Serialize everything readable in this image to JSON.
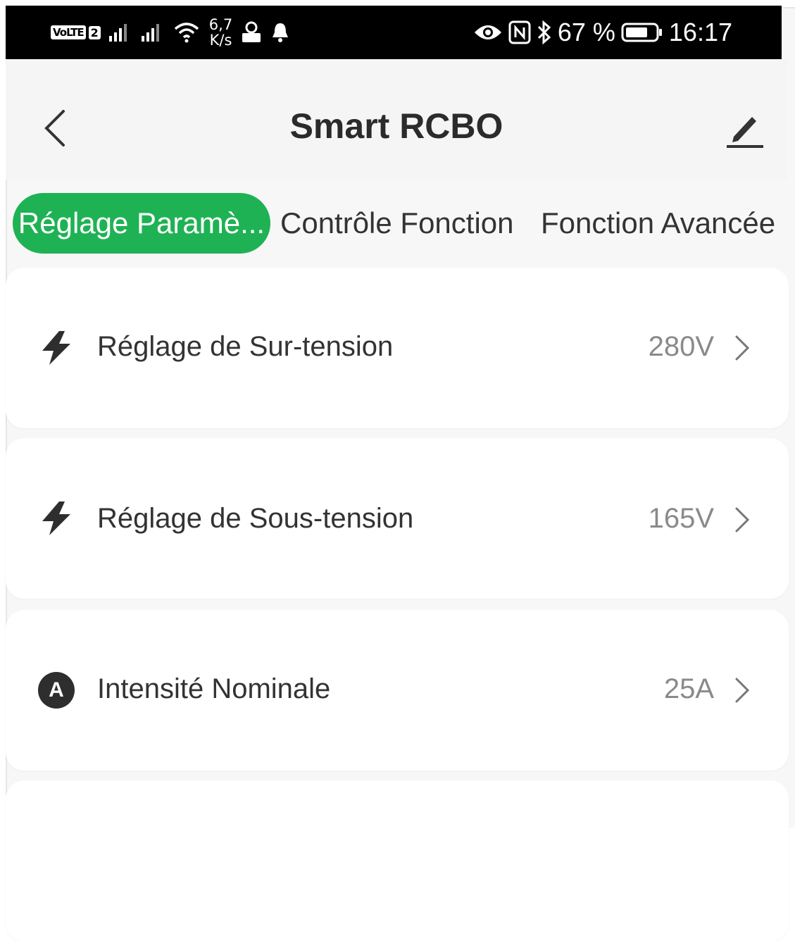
{
  "status_bar": {
    "volte": "VoLTE",
    "sim": "2",
    "speed_value": "6,7",
    "speed_unit": "K/s",
    "battery": "67 %",
    "time": "16:17"
  },
  "header": {
    "title": "Smart RCBO"
  },
  "tabs": [
    {
      "label": "Réglage Paramè...",
      "active": true
    },
    {
      "label": "Contrôle Fonction",
      "active": false
    },
    {
      "label": "Fonction Avancée",
      "active": false
    }
  ],
  "settings": [
    {
      "label": "Réglage de Sur-tension",
      "value": "280V",
      "icon": "lightning-icon"
    },
    {
      "label": "Réglage de Sous-tension",
      "value": "165V",
      "icon": "lightning-icon"
    },
    {
      "label": "Intensité Nominale",
      "value": "25A",
      "icon": "ampere-icon",
      "icon_text": "A"
    }
  ],
  "colors": {
    "accent": "#1fb254",
    "background": "#f7f7f7",
    "status_bar": "#000000"
  }
}
